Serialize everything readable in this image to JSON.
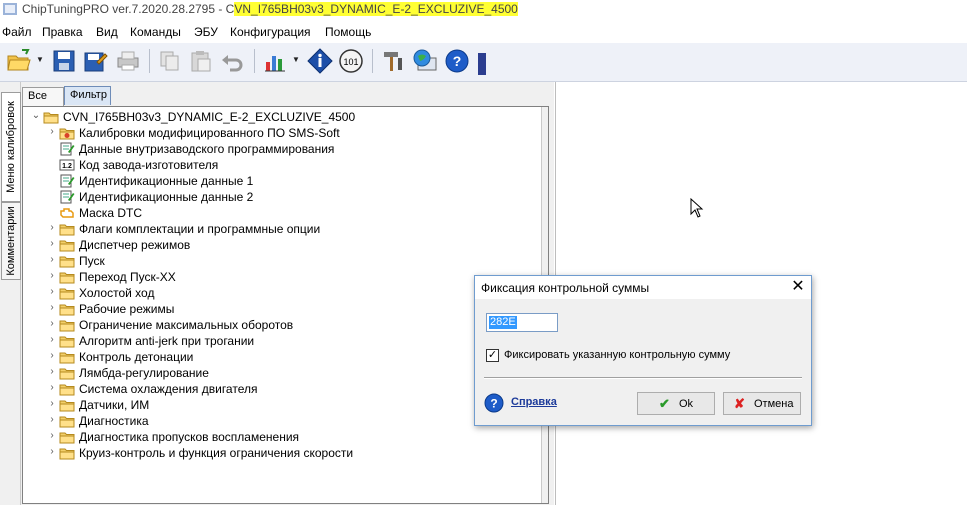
{
  "window": {
    "title_prefix": "ChipTuningPRO ver.7.2020.28.2795 - C",
    "title_highlight": "VN_I765BH03v3_DYNAMIC_E-2_EXCLUZIVE_4500"
  },
  "menu": [
    "Файл",
    "Правка",
    "Вид",
    "Команды",
    "ЭБУ",
    "Конфигурация",
    "Помощь"
  ],
  "toolbar": {
    "buttons": [
      "open-folder-icon",
      "save-icon",
      "save-as-icon",
      "print-icon",
      "copy-icon",
      "paste-icon",
      "undo-icon",
      "chart-icon",
      "info-diamond-icon",
      "calculator-icon",
      "tools-icon",
      "globe-monitor-icon",
      "help-icon"
    ]
  },
  "side_tabs": [
    "Меню калибровок",
    "Комментарии"
  ],
  "panel_tabs": [
    "Все",
    "Фильтр"
  ],
  "tree": {
    "root": "CVN_I765BH03v3_DYNAMIC_E-2_EXCLUZIVE_4500",
    "items": [
      {
        "label": "Калибровки модифицированного ПО SMS-Soft",
        "icon": "folder-star-icon",
        "expandable": true
      },
      {
        "label": "Данные внутризаводского программирования",
        "icon": "edit-doc-icon",
        "expandable": false
      },
      {
        "label": "Код завода-изготовителя",
        "icon": "number-icon",
        "expandable": false
      },
      {
        "label": "Идентификационные данные 1",
        "icon": "edit-doc-icon",
        "expandable": false
      },
      {
        "label": "Идентификационные данные 2",
        "icon": "edit-doc-icon",
        "expandable": false
      },
      {
        "label": "Маска DTC",
        "icon": "engine-icon",
        "expandable": false
      },
      {
        "label": "Флаги комплектации и программные опции",
        "icon": "folder-icon",
        "expandable": true
      },
      {
        "label": "Диспетчер режимов",
        "icon": "folder-icon",
        "expandable": true
      },
      {
        "label": "Пуск",
        "icon": "folder-icon",
        "expandable": true
      },
      {
        "label": "Переход Пуск-XX",
        "icon": "folder-icon",
        "expandable": true
      },
      {
        "label": "Холостой ход",
        "icon": "folder-icon",
        "expandable": true
      },
      {
        "label": "Рабочие режимы",
        "icon": "folder-icon",
        "expandable": true
      },
      {
        "label": "Ограничение максимальных оборотов",
        "icon": "folder-icon",
        "expandable": true
      },
      {
        "label": "Алгоритм anti-jerk при трогании",
        "icon": "folder-icon",
        "expandable": true
      },
      {
        "label": "Контроль детонации",
        "icon": "folder-icon",
        "expandable": true
      },
      {
        "label": "Лямбда-регулирование",
        "icon": "folder-icon",
        "expandable": true
      },
      {
        "label": "Система охлаждения двигателя",
        "icon": "folder-icon",
        "expandable": true
      },
      {
        "label": "Датчики, ИМ",
        "icon": "folder-icon",
        "expandable": true
      },
      {
        "label": "Диагностика",
        "icon": "folder-icon",
        "expandable": true
      },
      {
        "label": "Диагностика пропусков воспламенения",
        "icon": "folder-icon",
        "expandable": true
      },
      {
        "label": "Круиз-контроль и функция ограничения скорости",
        "icon": "folder-icon",
        "expandable": true
      }
    ]
  },
  "dialog": {
    "title": "Фиксация контрольной суммы",
    "checksum_value": "282E",
    "checkbox_label": "Фиксировать указанную контрольную сумму",
    "checkbox_checked": true,
    "help_label": "Справка",
    "ok_label": "Ok",
    "cancel_label": "Отмена"
  }
}
